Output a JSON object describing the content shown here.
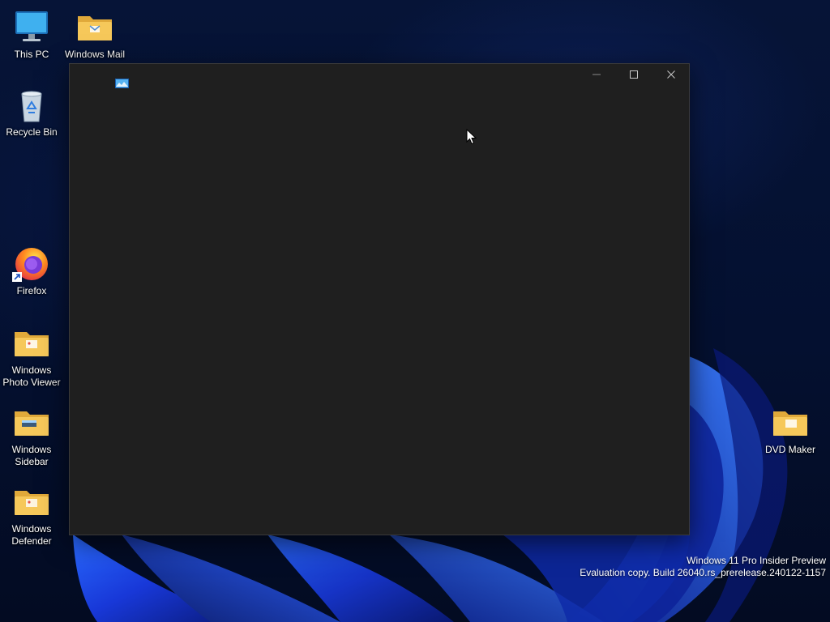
{
  "desktop": {
    "icons": [
      {
        "label": "This PC",
        "icon": "monitor-icon"
      },
      {
        "label": "Windows Mail",
        "icon": "folder-icon"
      },
      {
        "label": "Recycle Bin",
        "icon": "recycle-bin-icon"
      },
      {
        "label": "Firefox",
        "icon": "firefox-icon"
      },
      {
        "label": "Windows Photo Viewer",
        "icon": "folder-icon"
      },
      {
        "label": "Windows Sidebar",
        "icon": "folder-icon"
      },
      {
        "label": "Windows Defender",
        "icon": "folder-icon"
      },
      {
        "label": "DVD Maker",
        "icon": "folder-icon"
      }
    ]
  },
  "window": {
    "icon": "photo-viewer-app-icon",
    "controls": {
      "minimize": "minimize-icon",
      "maximize": "maximize-icon",
      "close": "close-icon"
    }
  },
  "watermark": {
    "line1": "Windows 11 Pro Insider Preview",
    "line2": "Evaluation copy. Build 26040.rs_prerelease.240122-1157"
  },
  "colors": {
    "desktop_bg": "#03102e",
    "bloom_blue": "#1e4bff",
    "window_bg": "#1f1f1f",
    "folder_yellow": "#f6c85a"
  }
}
